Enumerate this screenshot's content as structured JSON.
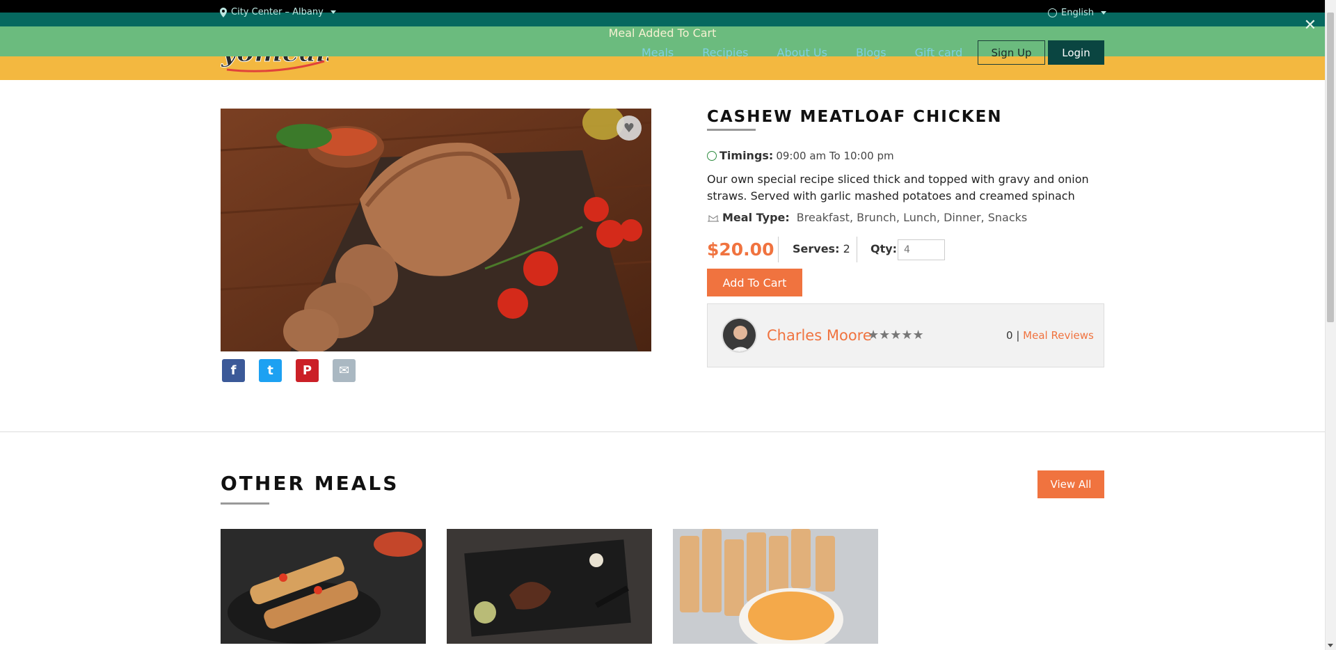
{
  "topbar": {
    "location": "City Center – Albany",
    "language": "English"
  },
  "toast": {
    "message": "Meal Added To Cart",
    "close_glyph": "✕"
  },
  "brand": {
    "logo_text": "yomeals"
  },
  "nav": {
    "items": [
      "Meals",
      "Recipies",
      "About Us",
      "Blogs",
      "Gift card"
    ],
    "signup": "Sign Up",
    "login": "Login"
  },
  "meal": {
    "title": "CASHEW MEATLOAF CHICKEN",
    "timings_label": "Timings:",
    "timings_value": "09:00 am To 10:00 pm",
    "description": "Our own special recipe sliced thick and topped with gravy and onion straws. Served with garlic mashed potatoes and creamed spinach",
    "meal_type_label": "Meal Type:",
    "meal_type_value": "Breakfast, Brunch, Lunch, Dinner, Snacks",
    "price": "$20.00",
    "serves_label": "Serves:",
    "serves_value": "2",
    "qty_label": "Qty:",
    "qty_value": "4",
    "add_to_cart": "Add To Cart"
  },
  "chef": {
    "name": "Charles Moore",
    "rating_stars": "★★★★★",
    "review_count": "0",
    "reviews_link": "Meal Reviews"
  },
  "social": [
    {
      "icon": "facebook-icon",
      "glyph": "f",
      "color": "#3b5998"
    },
    {
      "icon": "twitter-icon",
      "glyph": "t",
      "color": "#1da1f2"
    },
    {
      "icon": "pinterest-icon",
      "glyph": "P",
      "color": "#cb2027"
    },
    {
      "icon": "email-icon",
      "glyph": "✉",
      "color": "#aab8c2"
    }
  ],
  "other_meals": {
    "title": "OTHER MEALS",
    "view_all": "View All"
  },
  "colors": {
    "accent": "#f0733f",
    "teal": "#06685f",
    "yellow": "#f3b840",
    "toast": "#6bbb7e"
  }
}
